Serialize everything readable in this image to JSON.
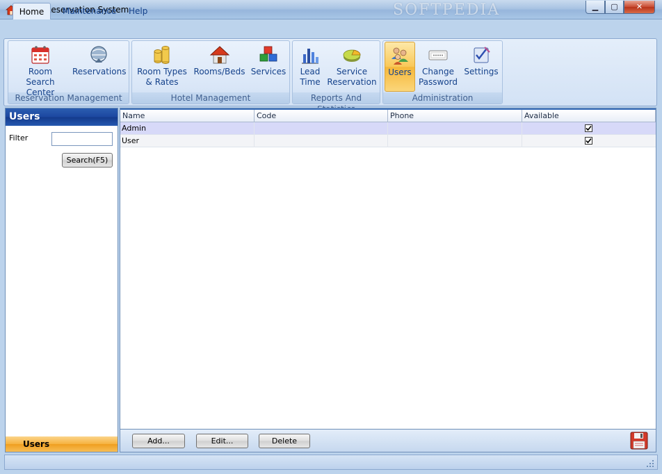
{
  "window": {
    "title": "Hotel Reservation System",
    "watermark": "SOFTPEDIA",
    "minimize_glyph": "▁",
    "maximize_glyph": "▢",
    "close_glyph": "✕"
  },
  "ribbon": {
    "tabs": [
      {
        "label": "Home",
        "selected": true
      },
      {
        "label": "Maintenance",
        "selected": false
      },
      {
        "label": "Help",
        "selected": false
      }
    ],
    "groups": [
      {
        "label": "Reservation Management",
        "buttons": [
          {
            "line1": "Room Search",
            "line2": "Center",
            "icon": "calendar-icon"
          },
          {
            "line1": "Reservations",
            "line2": "",
            "icon": "reservations-globe-icon"
          }
        ]
      },
      {
        "label": "Hotel Management",
        "buttons": [
          {
            "line1": "Room Types",
            "line2": "& Rates",
            "icon": "coins-icon"
          },
          {
            "line1": "Rooms/Beds",
            "line2": "",
            "icon": "house-icon"
          },
          {
            "line1": "Services",
            "line2": "",
            "icon": "cubes-icon"
          }
        ]
      },
      {
        "label": "Reports And Statistics",
        "buttons": [
          {
            "line1": "Lead",
            "line2": "Time",
            "icon": "bar-chart-icon"
          },
          {
            "line1": "Service",
            "line2": "Reservation",
            "icon": "pie-chart-icon"
          }
        ]
      },
      {
        "label": "Administration",
        "buttons": [
          {
            "line1": "Users",
            "line2": "",
            "icon": "users-icon",
            "selected": true
          },
          {
            "line1": "Change",
            "line2": "Password",
            "icon": "password-field-icon"
          },
          {
            "line1": "Settings",
            "line2": "",
            "icon": "settings-checklist-icon"
          }
        ]
      }
    ]
  },
  "left_panel": {
    "title": "Users",
    "filter_label": "Filter",
    "filter_value": "",
    "search_label": "Search(F5)",
    "footer_label": "Users"
  },
  "grid": {
    "columns": [
      "Name",
      "Code",
      "Phone",
      "Available"
    ],
    "rows": [
      {
        "name": "Admin",
        "code": "",
        "phone": "",
        "available": true,
        "selected": true
      },
      {
        "name": "User",
        "code": "",
        "phone": "",
        "available": true,
        "selected": false
      }
    ]
  },
  "actions": {
    "add_label": "Add...",
    "edit_label": "Edit...",
    "delete_label": "Delete",
    "save_icon": "floppy-disk-icon"
  },
  "colors": {
    "ribbon_blue": "#bcd3ec",
    "selection_orange": "#f6b23e",
    "header_blue": "#1c47a0",
    "row_selected": "#d7d9f8"
  }
}
